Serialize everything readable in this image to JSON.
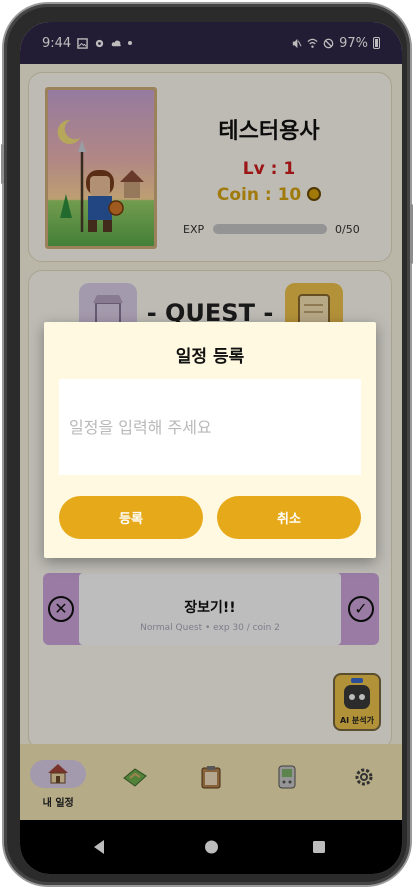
{
  "status_bar": {
    "time": "9:44",
    "battery": "97%",
    "icons": [
      "gallery-icon",
      "settings-gear-icon",
      "cloud-icon",
      "dot-icon",
      "mute-icon",
      "wifi-icon",
      "dnd-icon",
      "battery-icon"
    ]
  },
  "profile": {
    "name": "테스터용사",
    "level": "Lv : 1",
    "coin": "Coin : 10",
    "exp_label": "EXP",
    "exp_value": "0/50",
    "exp_fraction": 0
  },
  "quest": {
    "title": "- QUEST -",
    "items": [
      {
        "title": "장보기!!",
        "subtitle": "Normal Quest • exp 30 / coin 2"
      }
    ]
  },
  "ai_button": {
    "label": "AI 분석가"
  },
  "bottom_nav": {
    "items": [
      {
        "label": "내 일정",
        "icon": "house-icon"
      },
      {
        "label": "",
        "icon": "map-icon"
      },
      {
        "label": "",
        "icon": "clipboard-icon"
      },
      {
        "label": "",
        "icon": "device-icon"
      },
      {
        "label": "",
        "icon": "gear-icon"
      }
    ]
  },
  "dialog": {
    "title": "일정 등록",
    "input_placeholder": "일정을 입력해 주세요",
    "input_value": "",
    "confirm_label": "등록",
    "cancel_label": "취소"
  },
  "colors": {
    "status_bar": "#2e2747",
    "accent": "#e6a919",
    "level_red": "#d11d1d",
    "coin_gold": "#d8a60f",
    "quest_purple": "#cfa7de",
    "bottom_nav": "#f5e7b6"
  }
}
